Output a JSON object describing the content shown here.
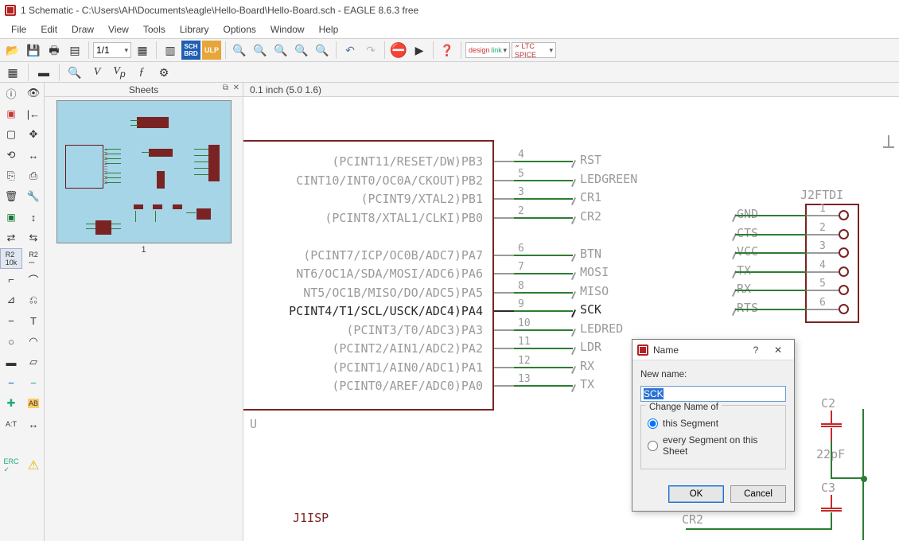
{
  "title": "1 Schematic - C:\\Users\\AH\\Documents\\eagle\\Hello-Board\\Hello-Board.sch - EAGLE 8.6.3 free",
  "menu": {
    "file": "File",
    "edit": "Edit",
    "draw": "Draw",
    "view": "View",
    "tools": "Tools",
    "library": "Library",
    "options": "Options",
    "window": "Window",
    "help": "Help"
  },
  "toolbar": {
    "zoom_dd": "1/1"
  },
  "sheets": {
    "title": "Sheets",
    "label": "1"
  },
  "coord": "0.1 inch (5.0 1.6)",
  "chip": {
    "ref": "U",
    "pins_right": [
      {
        "label": "(PCINT11/RESET/DW)PB3",
        "num": "4",
        "net": "RST"
      },
      {
        "label": "CINT10/INT0/OC0A/CKOUT)PB2",
        "num": "5",
        "net": "LEDGREEN"
      },
      {
        "label": "(PCINT9/XTAL2)PB1",
        "num": "3",
        "net": "CR1"
      },
      {
        "label": "(PCINT8/XTAL1/CLKI)PB0",
        "num": "2",
        "net": "CR2"
      },
      {
        "label": "",
        "num": "",
        "net": ""
      },
      {
        "label": "(PCINT7/ICP/OC0B/ADC7)PA7",
        "num": "6",
        "net": "BTN"
      },
      {
        "label": "NT6/OC1A/SDA/MOSI/ADC6)PA6",
        "num": "7",
        "net": "MOSI"
      },
      {
        "label": "NT5/OC1B/MISO/DO/ADC5)PA5",
        "num": "8",
        "net": "MISO"
      },
      {
        "label": "PCINT4/T1/SCL/USCK/ADC4)PA4",
        "num": "9",
        "net": "SCK",
        "selected": true
      },
      {
        "label": "(PCINT3/T0/ADC3)PA3",
        "num": "10",
        "net": "LEDRED"
      },
      {
        "label": "(PCINT2/AIN1/ADC2)PA2",
        "num": "11",
        "net": "LDR"
      },
      {
        "label": "(PCINT1/AIN0/ADC1)PA1",
        "num": "12",
        "net": "RX"
      },
      {
        "label": "(PCINT0/AREF/ADC0)PA0",
        "num": "13",
        "net": "TX"
      }
    ]
  },
  "ftdi": {
    "ref": "J2FTDI",
    "pins": [
      {
        "num": "1",
        "net": "GND"
      },
      {
        "num": "2",
        "net": "CTS"
      },
      {
        "num": "3",
        "net": "VCC"
      },
      {
        "num": "4",
        "net": "TX"
      },
      {
        "num": "5",
        "net": "RX"
      },
      {
        "num": "6",
        "net": "RTS"
      }
    ]
  },
  "bottom": {
    "j1": "J1ISP",
    "cr2": "CR2"
  },
  "caps": {
    "c2_ref": "C2",
    "c2_val": "22pF",
    "c3_ref": "C3"
  },
  "dialog": {
    "title": "Name",
    "label_new": "New name:",
    "input_value": "SCK",
    "group_title": "Change Name of",
    "radio1": "this Segment",
    "radio2": "every Segment on this Sheet",
    "ok": "OK",
    "cancel": "Cancel",
    "help": "?",
    "close": "✕"
  }
}
